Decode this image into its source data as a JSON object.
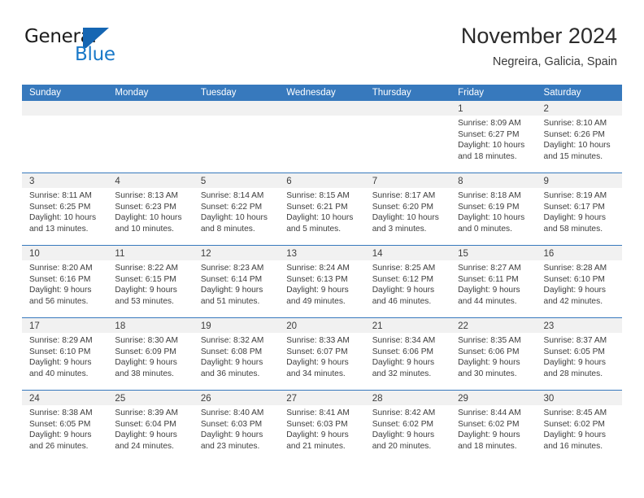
{
  "brand": {
    "name_part1": "General",
    "name_part2": "Blue",
    "logo_icon": "triangle-flag-logo",
    "accent_color": "#1878c8"
  },
  "header": {
    "title": "November 2024",
    "subtitle": "Negreira, Galicia, Spain"
  },
  "colors": {
    "header_row_blue": "#3779bd",
    "day_band_gray": "#f1f1f1",
    "text": "#3d3d3d"
  },
  "calendar": {
    "weekdays": [
      "Sunday",
      "Monday",
      "Tuesday",
      "Wednesday",
      "Thursday",
      "Friday",
      "Saturday"
    ],
    "weeks": [
      [
        {
          "day": "",
          "lines": []
        },
        {
          "day": "",
          "lines": []
        },
        {
          "day": "",
          "lines": []
        },
        {
          "day": "",
          "lines": []
        },
        {
          "day": "",
          "lines": []
        },
        {
          "day": "1",
          "lines": [
            "Sunrise: 8:09 AM",
            "Sunset: 6:27 PM",
            "Daylight: 10 hours",
            "and 18 minutes."
          ]
        },
        {
          "day": "2",
          "lines": [
            "Sunrise: 8:10 AM",
            "Sunset: 6:26 PM",
            "Daylight: 10 hours",
            "and 15 minutes."
          ]
        }
      ],
      [
        {
          "day": "3",
          "lines": [
            "Sunrise: 8:11 AM",
            "Sunset: 6:25 PM",
            "Daylight: 10 hours",
            "and 13 minutes."
          ]
        },
        {
          "day": "4",
          "lines": [
            "Sunrise: 8:13 AM",
            "Sunset: 6:23 PM",
            "Daylight: 10 hours",
            "and 10 minutes."
          ]
        },
        {
          "day": "5",
          "lines": [
            "Sunrise: 8:14 AM",
            "Sunset: 6:22 PM",
            "Daylight: 10 hours",
            "and 8 minutes."
          ]
        },
        {
          "day": "6",
          "lines": [
            "Sunrise: 8:15 AM",
            "Sunset: 6:21 PM",
            "Daylight: 10 hours",
            "and 5 minutes."
          ]
        },
        {
          "day": "7",
          "lines": [
            "Sunrise: 8:17 AM",
            "Sunset: 6:20 PM",
            "Daylight: 10 hours",
            "and 3 minutes."
          ]
        },
        {
          "day": "8",
          "lines": [
            "Sunrise: 8:18 AM",
            "Sunset: 6:19 PM",
            "Daylight: 10 hours",
            "and 0 minutes."
          ]
        },
        {
          "day": "9",
          "lines": [
            "Sunrise: 8:19 AM",
            "Sunset: 6:17 PM",
            "Daylight: 9 hours",
            "and 58 minutes."
          ]
        }
      ],
      [
        {
          "day": "10",
          "lines": [
            "Sunrise: 8:20 AM",
            "Sunset: 6:16 PM",
            "Daylight: 9 hours",
            "and 56 minutes."
          ]
        },
        {
          "day": "11",
          "lines": [
            "Sunrise: 8:22 AM",
            "Sunset: 6:15 PM",
            "Daylight: 9 hours",
            "and 53 minutes."
          ]
        },
        {
          "day": "12",
          "lines": [
            "Sunrise: 8:23 AM",
            "Sunset: 6:14 PM",
            "Daylight: 9 hours",
            "and 51 minutes."
          ]
        },
        {
          "day": "13",
          "lines": [
            "Sunrise: 8:24 AM",
            "Sunset: 6:13 PM",
            "Daylight: 9 hours",
            "and 49 minutes."
          ]
        },
        {
          "day": "14",
          "lines": [
            "Sunrise: 8:25 AM",
            "Sunset: 6:12 PM",
            "Daylight: 9 hours",
            "and 46 minutes."
          ]
        },
        {
          "day": "15",
          "lines": [
            "Sunrise: 8:27 AM",
            "Sunset: 6:11 PM",
            "Daylight: 9 hours",
            "and 44 minutes."
          ]
        },
        {
          "day": "16",
          "lines": [
            "Sunrise: 8:28 AM",
            "Sunset: 6:10 PM",
            "Daylight: 9 hours",
            "and 42 minutes."
          ]
        }
      ],
      [
        {
          "day": "17",
          "lines": [
            "Sunrise: 8:29 AM",
            "Sunset: 6:10 PM",
            "Daylight: 9 hours",
            "and 40 minutes."
          ]
        },
        {
          "day": "18",
          "lines": [
            "Sunrise: 8:30 AM",
            "Sunset: 6:09 PM",
            "Daylight: 9 hours",
            "and 38 minutes."
          ]
        },
        {
          "day": "19",
          "lines": [
            "Sunrise: 8:32 AM",
            "Sunset: 6:08 PM",
            "Daylight: 9 hours",
            "and 36 minutes."
          ]
        },
        {
          "day": "20",
          "lines": [
            "Sunrise: 8:33 AM",
            "Sunset: 6:07 PM",
            "Daylight: 9 hours",
            "and 34 minutes."
          ]
        },
        {
          "day": "21",
          "lines": [
            "Sunrise: 8:34 AM",
            "Sunset: 6:06 PM",
            "Daylight: 9 hours",
            "and 32 minutes."
          ]
        },
        {
          "day": "22",
          "lines": [
            "Sunrise: 8:35 AM",
            "Sunset: 6:06 PM",
            "Daylight: 9 hours",
            "and 30 minutes."
          ]
        },
        {
          "day": "23",
          "lines": [
            "Sunrise: 8:37 AM",
            "Sunset: 6:05 PM",
            "Daylight: 9 hours",
            "and 28 minutes."
          ]
        }
      ],
      [
        {
          "day": "24",
          "lines": [
            "Sunrise: 8:38 AM",
            "Sunset: 6:05 PM",
            "Daylight: 9 hours",
            "and 26 minutes."
          ]
        },
        {
          "day": "25",
          "lines": [
            "Sunrise: 8:39 AM",
            "Sunset: 6:04 PM",
            "Daylight: 9 hours",
            "and 24 minutes."
          ]
        },
        {
          "day": "26",
          "lines": [
            "Sunrise: 8:40 AM",
            "Sunset: 6:03 PM",
            "Daylight: 9 hours",
            "and 23 minutes."
          ]
        },
        {
          "day": "27",
          "lines": [
            "Sunrise: 8:41 AM",
            "Sunset: 6:03 PM",
            "Daylight: 9 hours",
            "and 21 minutes."
          ]
        },
        {
          "day": "28",
          "lines": [
            "Sunrise: 8:42 AM",
            "Sunset: 6:02 PM",
            "Daylight: 9 hours",
            "and 20 minutes."
          ]
        },
        {
          "day": "29",
          "lines": [
            "Sunrise: 8:44 AM",
            "Sunset: 6:02 PM",
            "Daylight: 9 hours",
            "and 18 minutes."
          ]
        },
        {
          "day": "30",
          "lines": [
            "Sunrise: 8:45 AM",
            "Sunset: 6:02 PM",
            "Daylight: 9 hours",
            "and 16 minutes."
          ]
        }
      ]
    ]
  }
}
